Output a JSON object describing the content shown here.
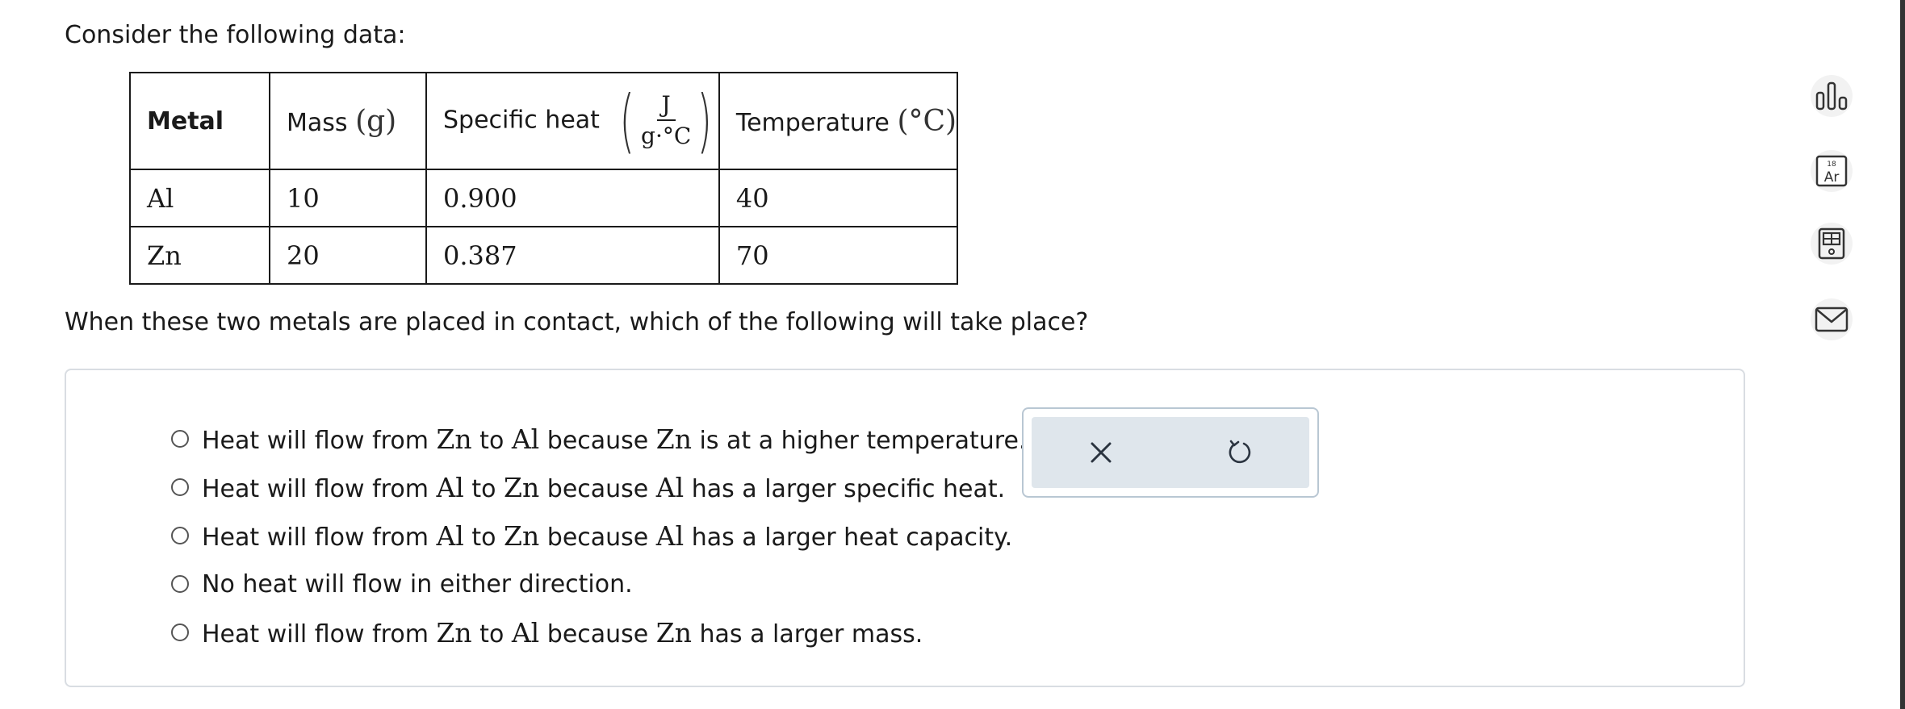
{
  "intro_text": "Consider the following data:",
  "table": {
    "headers": {
      "metal": "Metal",
      "mass_label": "Mass",
      "mass_unit": "(g)",
      "specific_heat_label": "Specific heat",
      "specific_heat_unit_num": "J",
      "specific_heat_unit_den": "g·°C",
      "temperature_label": "Temperature",
      "temperature_unit": "(°C)"
    },
    "rows": [
      {
        "metal": "Al",
        "mass": "10",
        "specific_heat": "0.900",
        "temperature": "40"
      },
      {
        "metal": "Zn",
        "mass": "20",
        "specific_heat": "0.387",
        "temperature": "70"
      }
    ]
  },
  "question_text": "When these two metals are placed in contact, which of the following will take place?",
  "choices": [
    {
      "parts": [
        "Heat will flow from ",
        "Zn",
        " to ",
        "Al",
        " because ",
        "Zn",
        " is at a higher temperature."
      ]
    },
    {
      "parts": [
        "Heat will flow from ",
        "Al",
        " to ",
        "Zn",
        " because ",
        "Al",
        " has a larger specific heat."
      ]
    },
    {
      "parts": [
        "Heat will flow from ",
        "Al",
        " to ",
        "Zn",
        " because ",
        "Al",
        " has a larger heat capacity."
      ]
    },
    {
      "parts": [
        "No heat will flow in either direction."
      ]
    },
    {
      "parts": [
        "Heat will flow from ",
        "Zn",
        " to ",
        "Al",
        " because ",
        "Zn",
        " has a larger mass."
      ]
    }
  ],
  "actions": {
    "clear_icon": "x-icon",
    "reset_icon": "undo-icon"
  },
  "tools": {
    "periodic_table_number": "18",
    "periodic_table_symbol": "Ar",
    "icons": [
      "bar-chart-icon",
      "periodic-table-icon",
      "calculator-icon",
      "mail-icon"
    ]
  },
  "colors": {
    "panel_bg": "#dfe6ec",
    "panel_border": "#b9c7d3",
    "box_border": "#d9dde2",
    "tool_bg": "#f2f2f2"
  }
}
